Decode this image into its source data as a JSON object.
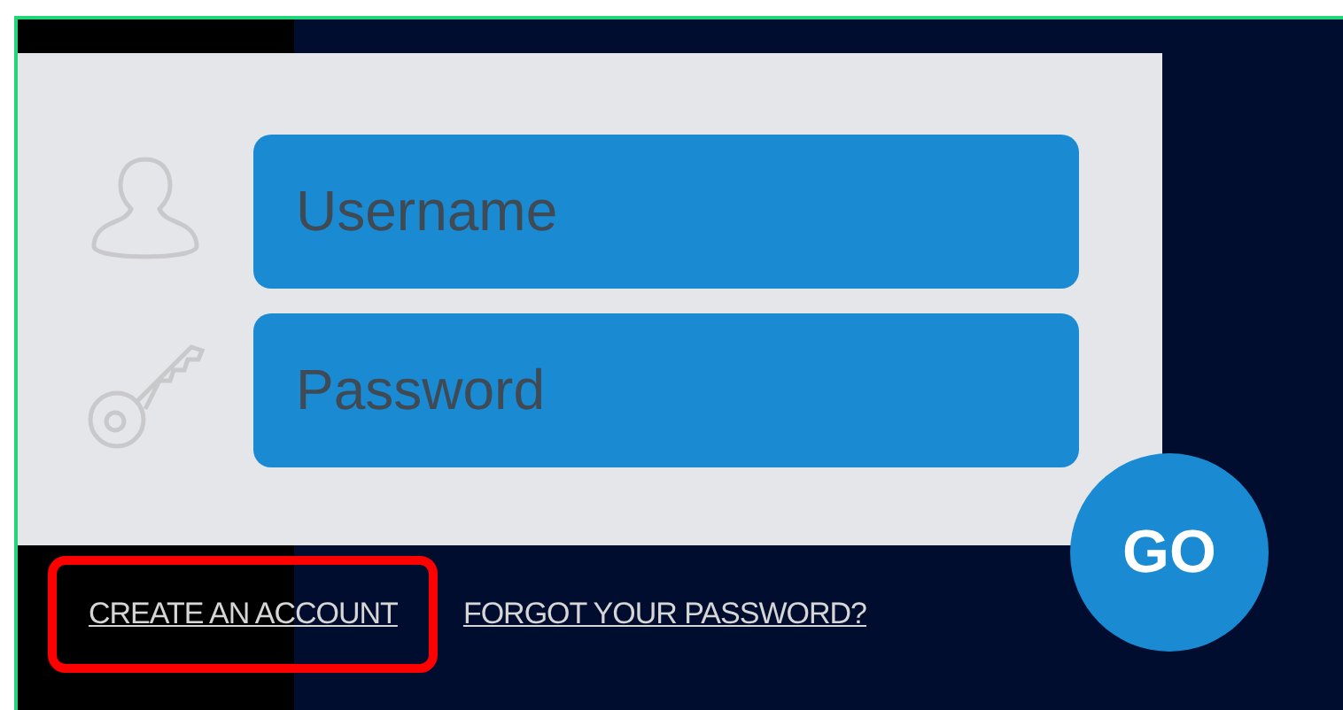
{
  "fields": [
    {
      "kind": "user",
      "placeholder": "Username"
    },
    {
      "kind": "key",
      "placeholder": "Password"
    }
  ],
  "submit": {
    "label": "GO"
  },
  "links": [
    {
      "label": "CREATE AN ACCOUNT",
      "highlighted": true
    },
    {
      "label": "FORGOT YOUR PASSWORD?",
      "highlighted": false
    }
  ]
}
